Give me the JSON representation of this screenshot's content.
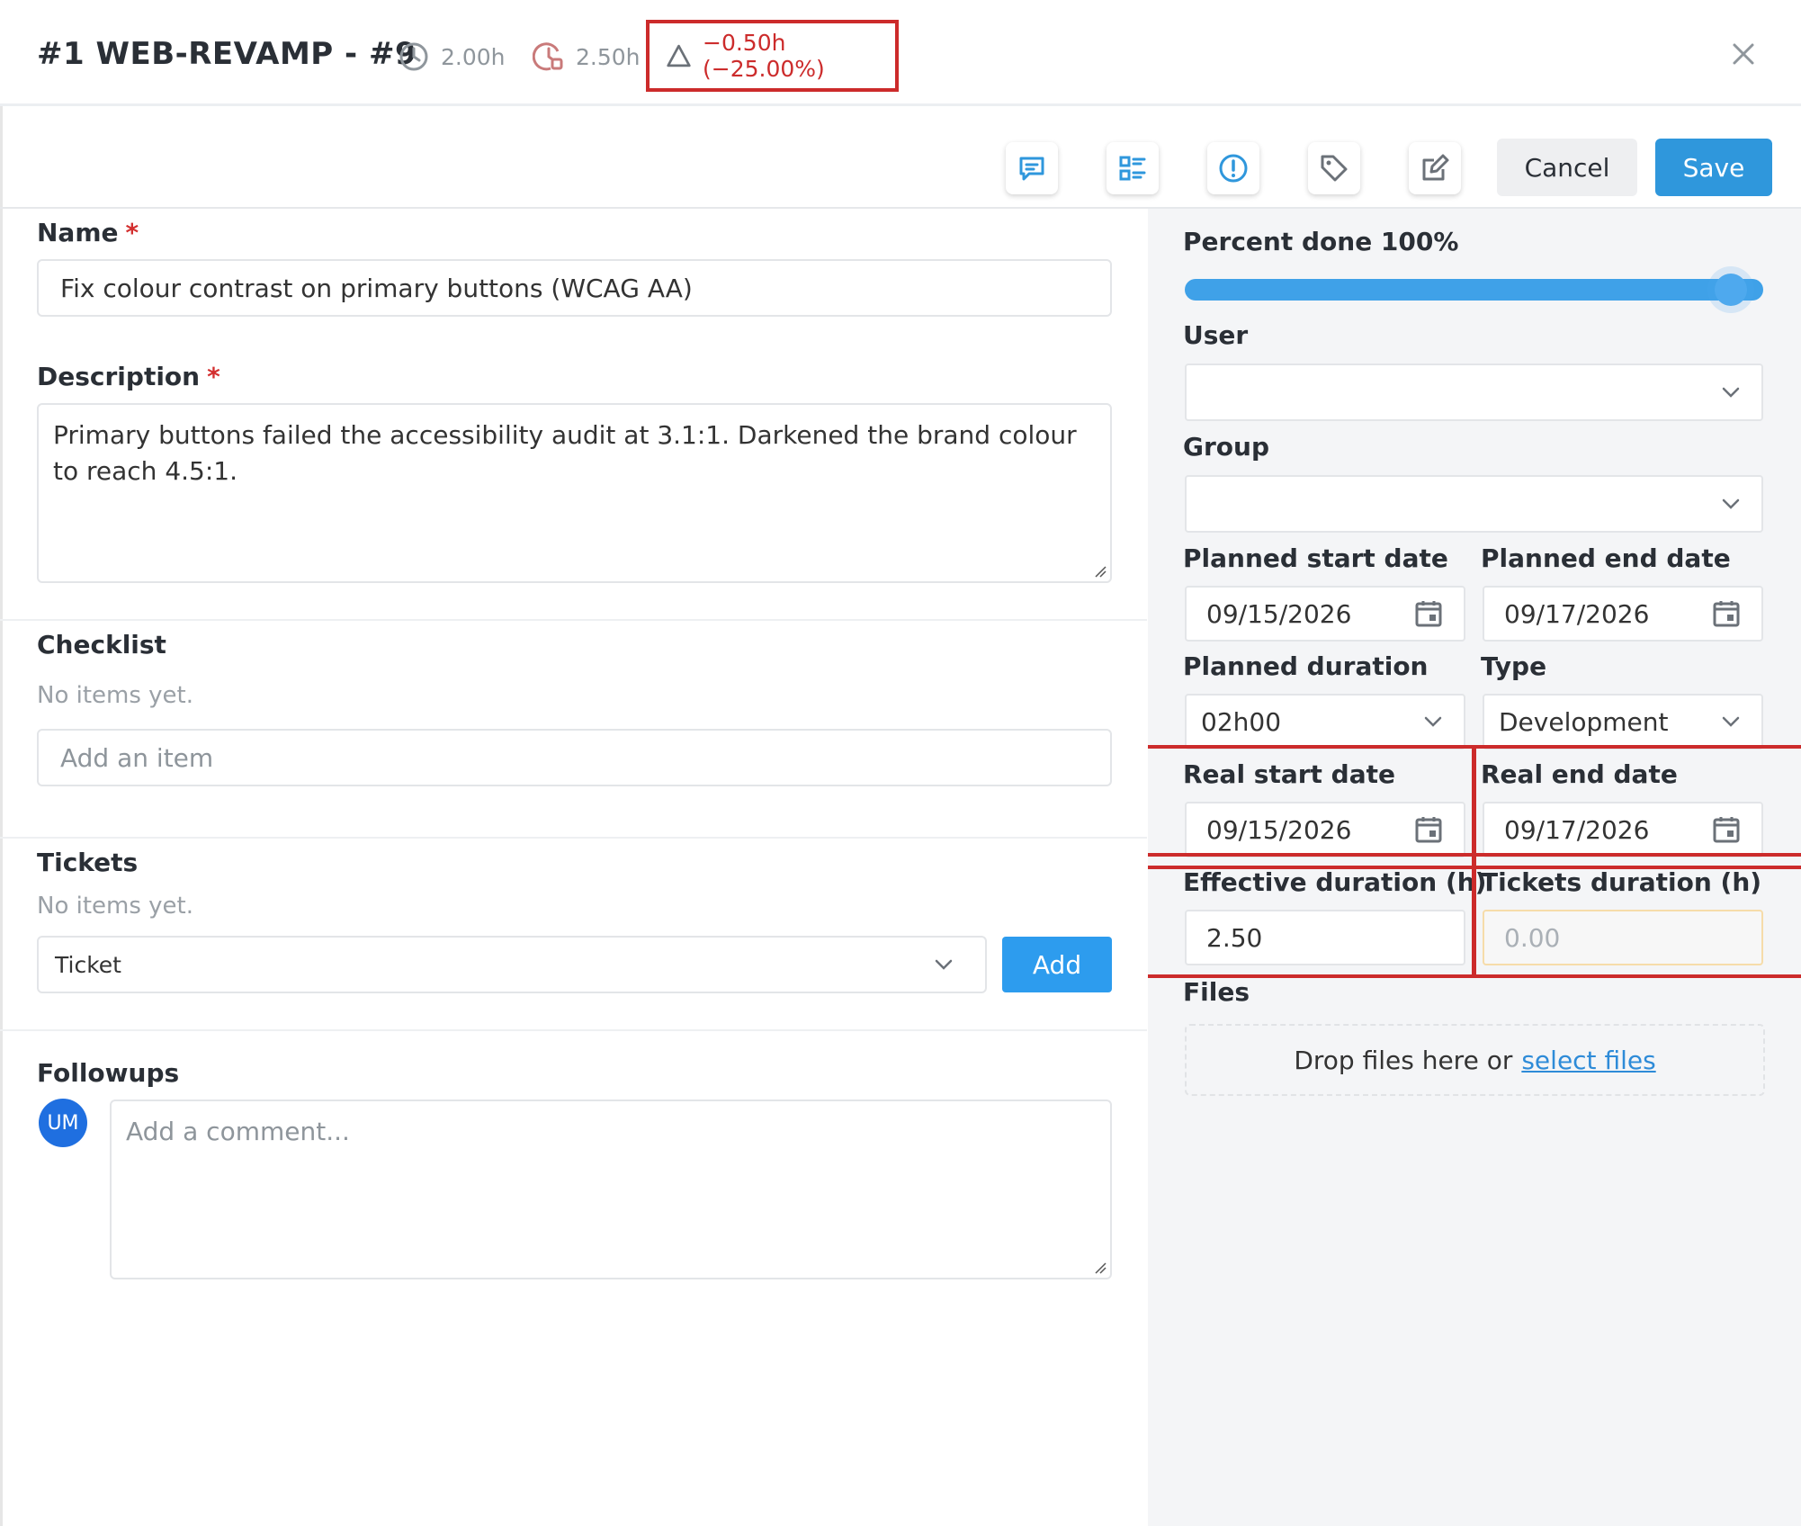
{
  "header": {
    "title": "#1 WEB-REVAMP - #9",
    "planned_hours": "2.00h",
    "effective_hours": "2.50h",
    "difference": "−0.50h (−25.00%)"
  },
  "toolbar": {
    "icons": [
      "comment-icon",
      "checklist-icon",
      "alert-icon",
      "tag-icon",
      "edit-icon"
    ],
    "cancel_label": "Cancel",
    "save_label": "Save"
  },
  "form": {
    "name_label": "Name",
    "required_mark": "*",
    "name_value": "Fix colour contrast on primary buttons (WCAG AA)",
    "description_label": "Description",
    "description_value": "Primary buttons failed the accessibility audit at 3.1:1. Darkened the brand colour to reach 4.5:1.",
    "checklist_label": "Checklist",
    "checklist_empty": "No items yet.",
    "checklist_placeholder": "Add an item",
    "tickets_label": "Tickets",
    "tickets_empty": "No items yet.",
    "ticket_select_value": "Ticket",
    "add_label": "Add",
    "followups_label": "Followups",
    "avatar_initials": "UM",
    "comment_placeholder": "Add a comment..."
  },
  "side": {
    "percent_label": "Percent done 100%",
    "percent_value": 1.0,
    "user_label": "User",
    "user_value": "",
    "group_label": "Group",
    "group_value": "",
    "planned_start_label": "Planned start date",
    "planned_start_value": "09/15/2026",
    "planned_end_label": "Planned end date",
    "planned_end_value": "09/17/2026",
    "planned_duration_label": "Planned duration",
    "planned_duration_value": "02h00",
    "type_label": "Type",
    "type_value": "Development",
    "real_start_label": "Real start date",
    "real_start_value": "09/15/2026",
    "real_end_label": "Real end date",
    "real_end_value": "09/17/2026",
    "effective_duration_label": "Effective duration (h)",
    "effective_duration_value": "2.50",
    "tickets_duration_label": "Tickets duration (h)",
    "tickets_duration_value": "0.00",
    "files_label": "Files",
    "drop_text": "Drop files here or",
    "select_files": "select files"
  },
  "colors": {
    "accent": "#2f97dc",
    "highlight": "#cc2b2b",
    "side_bg": "#f4f5f7"
  }
}
